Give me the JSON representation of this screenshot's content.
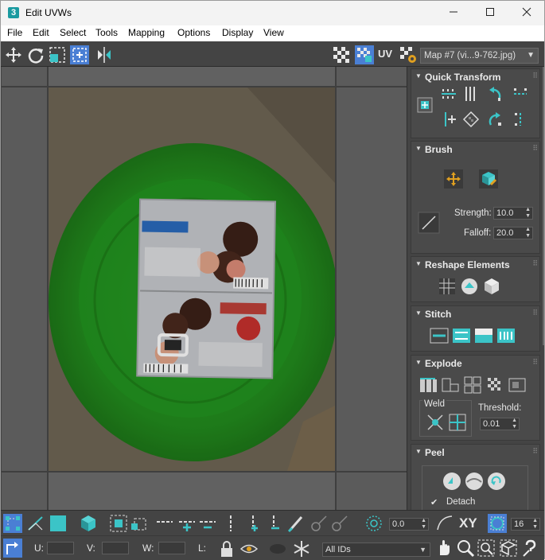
{
  "window": {
    "app_icon": "3",
    "title": "Edit UVWs",
    "minimize_icon": "minimize-icon",
    "maximize_icon": "maximize-icon",
    "close_icon": "close-icon"
  },
  "menu": {
    "items": [
      "File",
      "Edit",
      "Select",
      "Tools",
      "Mapping",
      "Options",
      "Display",
      "View"
    ]
  },
  "toolbar": {
    "uv_label": "UV",
    "map_select": "Map #7 (vi...9-762.jpg)"
  },
  "panel": {
    "quick_transform": {
      "title": "Quick Transform"
    },
    "brush": {
      "title": "Brush",
      "strength_label": "Strength:",
      "strength_value": "10.0",
      "falloff_label": "Falloff:",
      "falloff_value": "20.0"
    },
    "reshape": {
      "title": "Reshape Elements"
    },
    "stitch": {
      "title": "Stitch"
    },
    "explode": {
      "title": "Explode",
      "weld_label": "Weld",
      "threshold_label": "Threshold:",
      "threshold_value": "0.01"
    },
    "peel": {
      "title": "Peel",
      "detach_label": "Detach",
      "detach_checked": true
    }
  },
  "bottom": {
    "angle_value": "0.0",
    "xy_label": "XY",
    "count_value": "16",
    "u_label": "U:",
    "v_label": "V:",
    "w_label": "W:",
    "l_label": "L:",
    "ids_select": "All IDs"
  },
  "colors": {
    "accent_teal": "#3bc4c7",
    "panel_bg": "#444444",
    "viewport_bg": "#5b5b5b",
    "highlight_blue": "#4a7fd4"
  }
}
